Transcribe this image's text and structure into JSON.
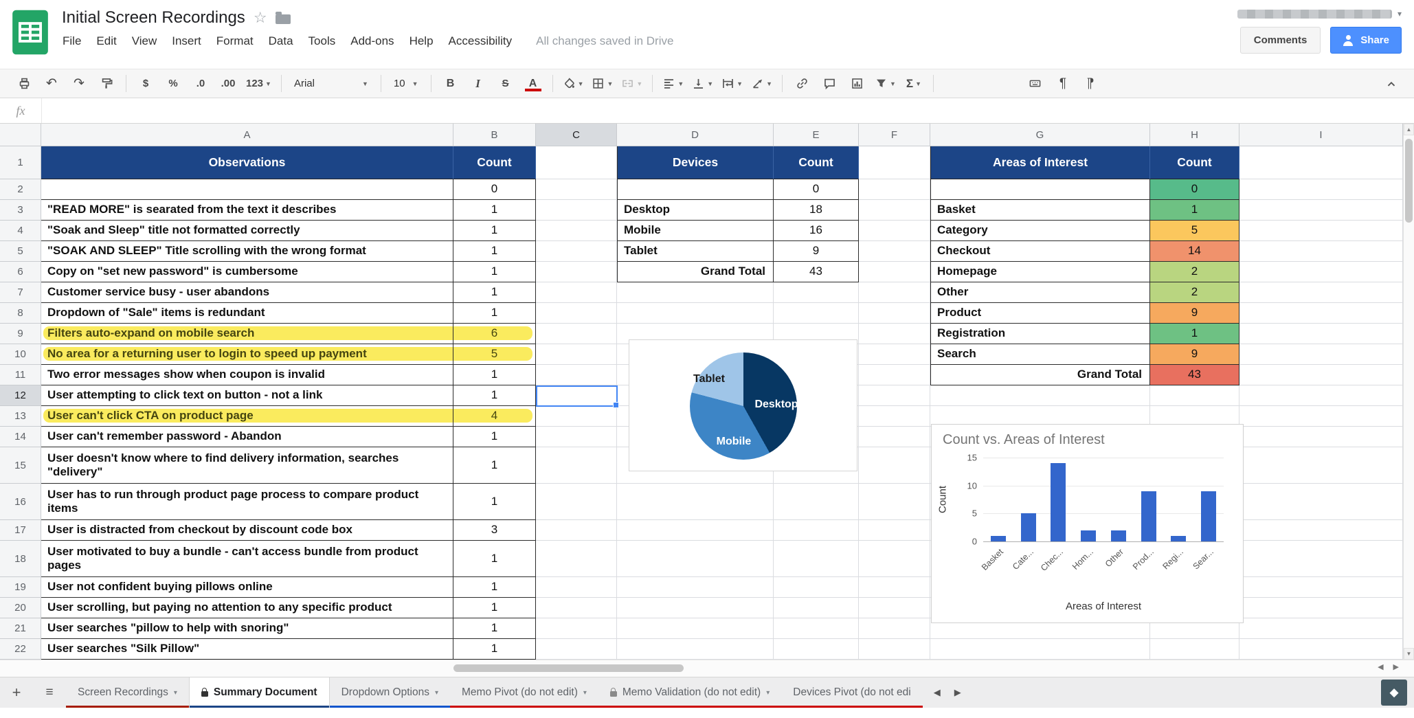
{
  "header": {
    "title": "Initial Screen Recordings",
    "save_status": "All changes saved in Drive",
    "comments_label": "Comments",
    "share_label": "Share",
    "menus": [
      "File",
      "Edit",
      "View",
      "Insert",
      "Format",
      "Data",
      "Tools",
      "Add-ons",
      "Help",
      "Accessibility"
    ]
  },
  "toolbar": {
    "items": [
      {
        "type": "icon",
        "name": "print-icon"
      },
      {
        "type": "glyph",
        "name": "undo-icon",
        "glyph": "↶"
      },
      {
        "type": "glyph",
        "name": "redo-icon",
        "glyph": "↷"
      },
      {
        "type": "icon",
        "name": "paint-format-icon"
      },
      {
        "type": "divider"
      },
      {
        "type": "text",
        "name": "format-currency-button",
        "label": "$"
      },
      {
        "type": "text",
        "name": "format-percent-button",
        "label": "%"
      },
      {
        "type": "text",
        "name": "decrease-decimal-button",
        "label": ".0"
      },
      {
        "type": "text",
        "name": "increase-decimal-button",
        "label": ".00"
      },
      {
        "type": "text",
        "name": "number-format-button",
        "label": "123",
        "caret": true
      },
      {
        "type": "divider"
      },
      {
        "type": "select",
        "name": "font-family-select",
        "label": "Arial",
        "wide": true
      },
      {
        "type": "divider"
      },
      {
        "type": "select",
        "name": "font-size-select",
        "label": "10"
      },
      {
        "type": "divider"
      },
      {
        "type": "text",
        "name": "bold-button",
        "label": "B"
      },
      {
        "type": "text",
        "name": "italic-button",
        "label": "I"
      },
      {
        "type": "text",
        "name": "strikethrough-button",
        "label": "S"
      },
      {
        "type": "text",
        "name": "text-color-button",
        "label": "A"
      },
      {
        "type": "divider"
      },
      {
        "type": "icon",
        "name": "fill-color-icon",
        "caret": true
      },
      {
        "type": "icon",
        "name": "borders-icon",
        "caret": true
      },
      {
        "type": "icon",
        "name": "merge-cells-icon",
        "caret": true,
        "disabled": true
      },
      {
        "type": "divider"
      },
      {
        "type": "icon",
        "name": "horizontal-align-icon",
        "caret": true
      },
      {
        "type": "icon",
        "name": "vertical-align-icon",
        "caret": true
      },
      {
        "type": "icon",
        "name": "text-wrap-icon",
        "caret": true
      },
      {
        "type": "icon",
        "name": "text-rotation-icon",
        "caret": true
      },
      {
        "type": "divider"
      },
      {
        "type": "icon",
        "name": "insert-link-icon"
      },
      {
        "type": "icon",
        "name": "insert-comment-icon"
      },
      {
        "type": "icon",
        "name": "insert-chart-icon"
      },
      {
        "type": "icon",
        "name": "filter-icon",
        "caret": true
      },
      {
        "type": "text",
        "name": "functions-button",
        "label": "Σ",
        "caret": true
      },
      {
        "type": "divider"
      },
      {
        "type": "icon",
        "name": "keyboard-input-icon"
      },
      {
        "type": "glyph",
        "name": "paragraph-direction-ltr-icon",
        "glyph": "¶"
      },
      {
        "type": "glyph",
        "name": "paragraph-direction-rtl-icon",
        "glyph": "¶"
      }
    ]
  },
  "formula_bar": {
    "fx_label": "fx",
    "value": ""
  },
  "sheet": {
    "column_headers": [
      "A",
      "B",
      "C",
      "D",
      "E",
      "F",
      "G",
      "H",
      "I"
    ],
    "visible_rows": 22,
    "selection": {
      "cell": "C12",
      "column": "C",
      "row": 12
    },
    "header_fill": "#1c4587",
    "tables": {
      "observations": {
        "header_label": "Observations",
        "count_label": "Count",
        "highlighted_rows": [
          9,
          10,
          13
        ],
        "highlight_color": "#f9e73a",
        "rows": [
          {
            "row": 2,
            "text": "",
            "count": "0"
          },
          {
            "row": 3,
            "text": "\"READ MORE\" is searated from the text it describes",
            "count": "1"
          },
          {
            "row": 4,
            "text": "\"Soak and Sleep\" title not formatted correctly",
            "count": "1"
          },
          {
            "row": 5,
            "text": "\"SOAK AND SLEEP\" Title scrolling with the wrong format",
            "count": "1"
          },
          {
            "row": 6,
            "text": "Copy on \"set new password\" is cumbersome",
            "count": "1"
          },
          {
            "row": 7,
            "text": "Customer service busy - user abandons",
            "count": "1"
          },
          {
            "row": 8,
            "text": "Dropdown of \"Sale\" items is redundant",
            "count": "1"
          },
          {
            "row": 9,
            "text": "Filters auto-expand on mobile search",
            "count": "6"
          },
          {
            "row": 10,
            "text": "No area for a returning user to login to speed up payment",
            "count": "5"
          },
          {
            "row": 11,
            "text": "Two error messages show when coupon is invalid",
            "count": "1"
          },
          {
            "row": 12,
            "text": "User attempting to click text on button - not a link",
            "count": "1"
          },
          {
            "row": 13,
            "text": "User can't click CTA on product page",
            "count": "4"
          },
          {
            "row": 14,
            "text": "User can't remember password - Abandon",
            "count": "1"
          },
          {
            "row": 15,
            "text": "User doesn't know where to find delivery information, searches \"delivery\"",
            "count": "1"
          },
          {
            "row": 16,
            "text": "User has to run through product page process to compare product items",
            "count": "1"
          },
          {
            "row": 17,
            "text": "User is distracted from checkout by discount code box",
            "count": "3"
          },
          {
            "row": 18,
            "text": "User motivated to buy a bundle - can't access bundle from product pages",
            "count": "1"
          },
          {
            "row": 19,
            "text": "User not confident buying pillows online",
            "count": "1"
          },
          {
            "row": 20,
            "text": "User scrolling, but paying no attention to any specific product",
            "count": "1"
          },
          {
            "row": 21,
            "text": "User searches \"pillow to help with snoring\"",
            "count": "1"
          },
          {
            "row": 22,
            "text": "User searches \"Silk Pillow\"",
            "count": "1"
          }
        ]
      },
      "devices": {
        "header_label": "Devices",
        "count_label": "Count",
        "rows": [
          {
            "row": 2,
            "label": "",
            "count": "0"
          },
          {
            "row": 3,
            "label": "Desktop",
            "count": "18"
          },
          {
            "row": 4,
            "label": "Mobile",
            "count": "16"
          },
          {
            "row": 5,
            "label": "Tablet",
            "count": "9"
          },
          {
            "row": 6,
            "label": "Grand Total",
            "count": "43",
            "total": true
          }
        ]
      },
      "areas": {
        "header_label": "Areas of Interest",
        "count_label": "Count",
        "rows": [
          {
            "row": 2,
            "label": "",
            "count": "0",
            "color": "#57bb8a"
          },
          {
            "row": 3,
            "label": "Basket",
            "count": "1",
            "color": "#6ec183"
          },
          {
            "row": 4,
            "label": "Category",
            "count": "5",
            "color": "#fbc75d"
          },
          {
            "row": 5,
            "label": "Checkout",
            "count": "14",
            "color": "#f0926c"
          },
          {
            "row": 6,
            "label": "Homepage",
            "count": "2",
            "color": "#b9d580"
          },
          {
            "row": 7,
            "label": "Other",
            "count": "2",
            "color": "#b9d580"
          },
          {
            "row": 8,
            "label": "Product",
            "count": "9",
            "color": "#f6a95e"
          },
          {
            "row": 9,
            "label": "Registration",
            "count": "1",
            "color": "#6ec183"
          },
          {
            "row": 10,
            "label": "Search",
            "count": "9",
            "color": "#f6a95e"
          },
          {
            "row": 11,
            "label": "Grand Total",
            "count": "43",
            "color": "#e8705f",
            "total": true
          }
        ]
      }
    }
  },
  "chart_data": [
    {
      "type": "pie",
      "title": "",
      "labels": [
        "Desktop",
        "Mobile",
        "Tablet"
      ],
      "values": [
        18,
        16,
        9
      ],
      "colors": [
        "#073763",
        "#3d85c6",
        "#9fc5e8"
      ],
      "label_text_colors": [
        "#ffffff",
        "#ffffff",
        "#1a1a1a"
      ],
      "legend": false
    },
    {
      "type": "bar",
      "title": "Count vs. Areas of Interest",
      "categories": [
        "Basket",
        "Category",
        "Checkout",
        "Homepage",
        "Other",
        "Product",
        "Registration",
        "Search"
      ],
      "tick_labels": [
        "Basket",
        "Cate...",
        "Chec...",
        "Hom...",
        "Other",
        "Prod...",
        "Regi...",
        "Sear..."
      ],
      "values": [
        1,
        5,
        14,
        2,
        2,
        9,
        1,
        9
      ],
      "xlabel": "Areas of Interest",
      "ylabel": "Count",
      "ylim": [
        0,
        15
      ],
      "yticks": [
        0,
        5,
        10,
        15
      ],
      "bar_color": "#3366cc",
      "grid": true,
      "legend": false
    }
  ],
  "tabbar": {
    "tabs": [
      {
        "label": "Screen Recordings",
        "color": "#a61c00",
        "active": false,
        "lock": false
      },
      {
        "label": "Summary Document",
        "color": "#1c4587",
        "active": true,
        "lock": true
      },
      {
        "label": "Dropdown Options",
        "color": "#1155cc",
        "active": false,
        "lock": false
      },
      {
        "label": "Memo Pivot (do not edit)",
        "color": "#cc0000",
        "active": false,
        "lock": false
      },
      {
        "label": "Memo Validation (do not edit)",
        "color": "#cc0000",
        "active": false,
        "lock": true
      },
      {
        "label": "Devices Pivot (do not edi",
        "color": "#cc0000",
        "active": false,
        "lock": false,
        "clipped": true
      }
    ]
  }
}
